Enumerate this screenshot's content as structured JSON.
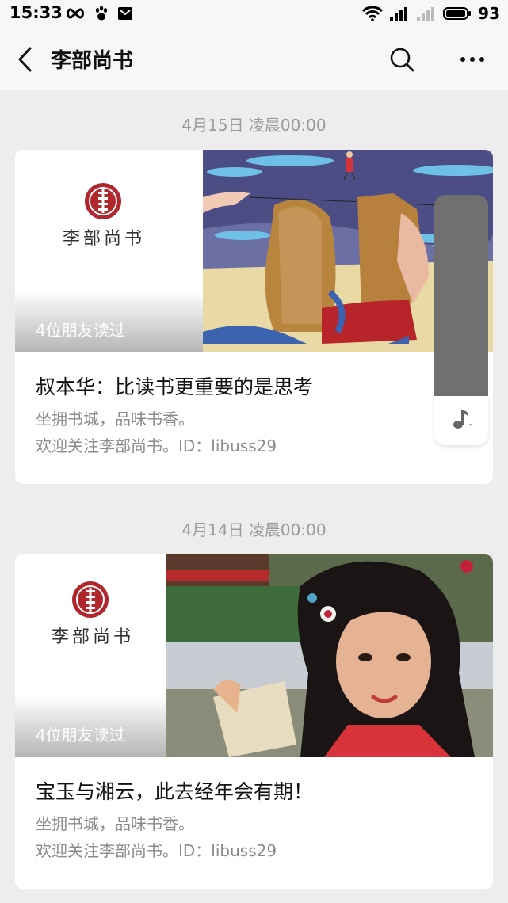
{
  "status_bar": {
    "time": "15:33",
    "battery": "93"
  },
  "nav": {
    "title": "李部尚书"
  },
  "articles": [
    {
      "timestamp": "4月15日 凌晨00:00",
      "logo_text": "李部尚书",
      "friends_read": "4位朋友读过",
      "title": "叔本华：比读书更重要的是思考",
      "desc_line1": "坐拥书城，品味书香。",
      "desc_line2": "欢迎关注李部尚书。ID：libuss29"
    },
    {
      "timestamp": "4月14日 凌晨00:00",
      "logo_text": "李部尚书",
      "friends_read": "4位朋友读过",
      "title": "宝玉与湘云，此去经年会有期！",
      "desc_line1": "坐拥书城，品味书香。",
      "desc_line2": "欢迎关注李部尚书。ID：libuss29"
    }
  ],
  "icons": {
    "back": "chevron-left-icon",
    "search": "search-icon",
    "more": "more-icon",
    "music": "music-note-icon"
  },
  "colors": {
    "background": "#ededed",
    "logo_red": "#b0272d",
    "secondary_text": "#8a8a8a"
  }
}
